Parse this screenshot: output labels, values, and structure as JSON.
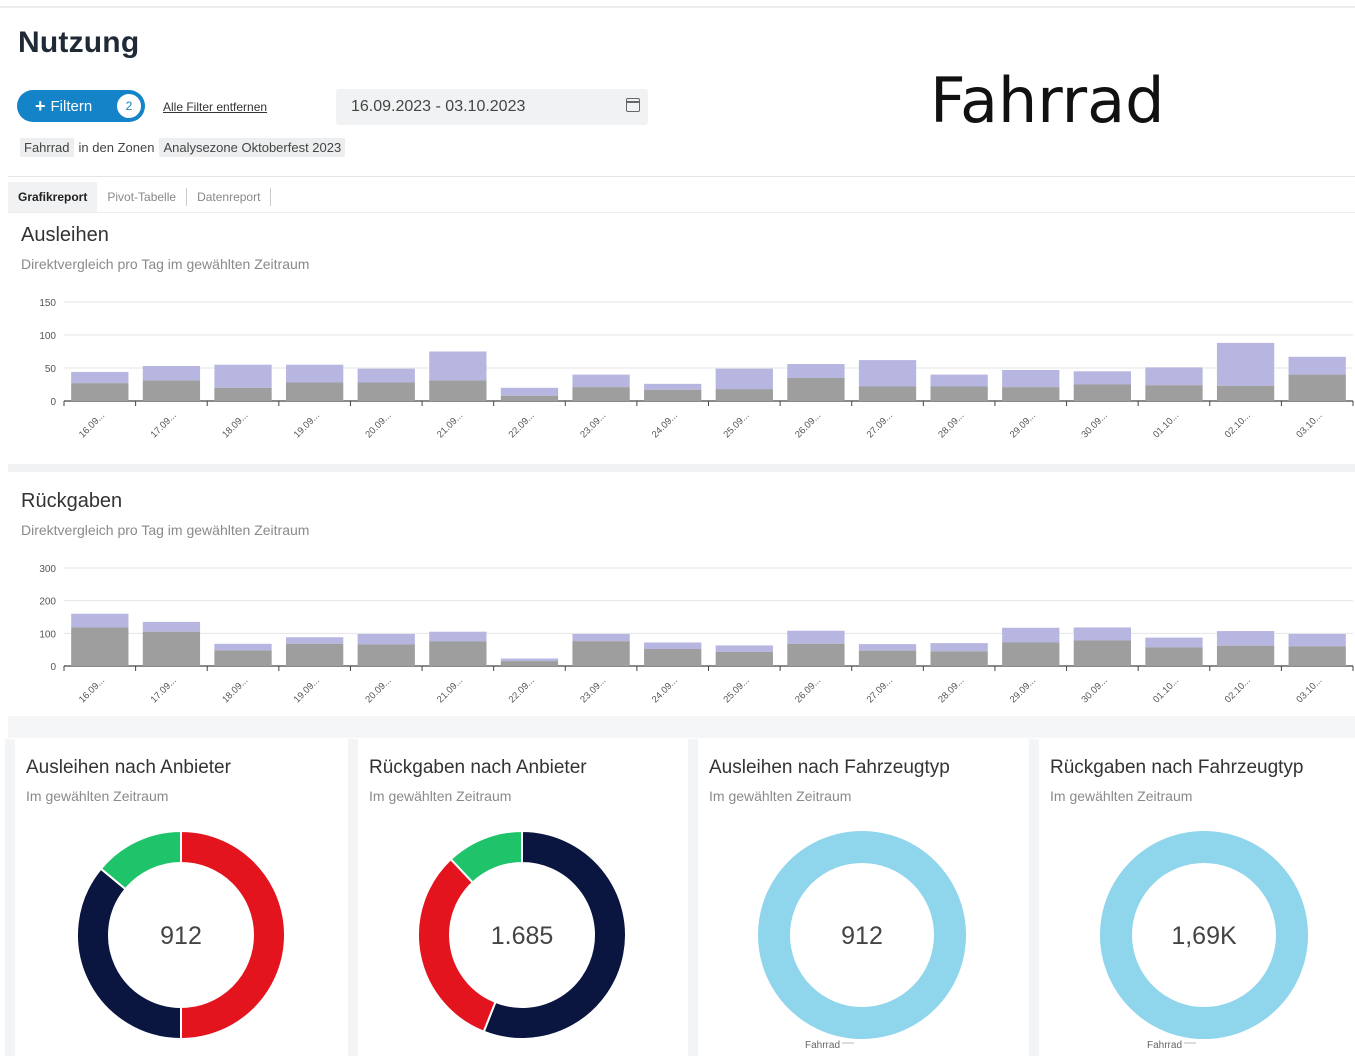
{
  "page": {
    "title": "Nutzung",
    "overlay_label": "Fahrrad"
  },
  "filter": {
    "button_label": "Filtern",
    "badge_count": "2",
    "remove_all": "Alle Filter entfernen",
    "date_range": "16.09.2023 - 03.10.2023",
    "chips": [
      "Fahrrad",
      "in den Zonen",
      "Analysezone Oktoberfest 2023"
    ]
  },
  "tabs": [
    {
      "label": "Grafikreport",
      "active": true
    },
    {
      "label": "Pivot-Tabelle",
      "active": false
    },
    {
      "label": "Datenreport",
      "active": false
    }
  ],
  "colors": {
    "accent": "#1583c7",
    "bar_bottom": "#9e9e9e",
    "bar_top": "#b6b6e0",
    "red": "#e3141e",
    "navy": "#0a1640",
    "green": "#1fc46a",
    "lightblue": "#8fd5ec"
  },
  "rentals": {
    "title": "Ausleihen",
    "subtitle": "Direktvergleich pro Tag im gewählten Zeitraum"
  },
  "returns": {
    "title": "Rückgaben",
    "subtitle": "Direktvergleich pro Tag im gewählten Zeitraum"
  },
  "cards": [
    {
      "title": "Ausleihen nach Anbieter",
      "subtitle": "Im gewählten Zeitraum",
      "center": "912",
      "footer": ""
    },
    {
      "title": "Rückgaben nach Anbieter",
      "subtitle": "Im gewählten Zeitraum",
      "center": "1.685",
      "footer": ""
    },
    {
      "title": "Ausleihen nach Fahrzeugtyp",
      "subtitle": "Im gewählten Zeitraum",
      "center": "912",
      "footer": "Fahrrad"
    },
    {
      "title": "Rückgaben nach Fahrzeugtyp",
      "subtitle": "Im gewählten Zeitraum",
      "center": "1,69K",
      "footer": "Fahrrad"
    }
  ],
  "chart_data": [
    {
      "type": "bar",
      "stacked": true,
      "categories": [
        "16.09.",
        "17.09.",
        "18.09.",
        "19.09.",
        "20.09.",
        "21.09.",
        "22.09.",
        "23.09.",
        "24.09.",
        "25.09.",
        "26.09.",
        "27.09.",
        "28.09.",
        "29.09.",
        "30.09.",
        "01.10.",
        "02.10.",
        "03.10."
      ],
      "series": [
        {
          "values": [
            27,
            31,
            20,
            28,
            28,
            31,
            8,
            21,
            17,
            18,
            35,
            22,
            22,
            21,
            25,
            24,
            23,
            40
          ]
        },
        {
          "values": [
            17,
            22,
            35,
            27,
            21,
            44,
            12,
            19,
            9,
            31,
            21,
            40,
            18,
            26,
            20,
            27,
            65,
            27
          ]
        }
      ],
      "ylim": [
        0,
        150
      ],
      "yticks": [
        0,
        50,
        100,
        150
      ],
      "grid": true
    },
    {
      "type": "bar",
      "stacked": true,
      "categories": [
        "16.09.",
        "17.09.",
        "18.09.",
        "19.09.",
        "20.09.",
        "21.09.",
        "22.09.",
        "23.09.",
        "24.09.",
        "25.09.",
        "26.09.",
        "27.09.",
        "28.09.",
        "29.09.",
        "30.09.",
        "01.10.",
        "02.10.",
        "03.10."
      ],
      "series": [
        {
          "values": [
            118,
            105,
            48,
            68,
            66,
            75,
            15,
            76,
            52,
            43,
            68,
            47,
            45,
            72,
            78,
            57,
            62,
            60
          ]
        },
        {
          "values": [
            42,
            30,
            20,
            20,
            32,
            30,
            8,
            22,
            20,
            20,
            40,
            20,
            25,
            45,
            40,
            30,
            45,
            38
          ]
        }
      ],
      "ylim": [
        0,
        300
      ],
      "yticks": [
        0,
        100,
        200,
        300
      ],
      "grid": true
    },
    {
      "type": "pie",
      "donut": true,
      "center_label": "912",
      "slices": [
        {
          "value": 50,
          "color": "#e3141e"
        },
        {
          "value": 36,
          "color": "#0a1640"
        },
        {
          "value": 14,
          "color": "#1fc46a"
        }
      ]
    },
    {
      "type": "pie",
      "donut": true,
      "center_label": "1.685",
      "slices": [
        {
          "value": 56,
          "color": "#0a1640"
        },
        {
          "value": 32,
          "color": "#e3141e"
        },
        {
          "value": 12,
          "color": "#1fc46a"
        }
      ]
    },
    {
      "type": "pie",
      "donut": true,
      "center_label": "912",
      "slices": [
        {
          "name": "Fahrrad",
          "value": 100,
          "color": "#8fd5ec"
        }
      ]
    },
    {
      "type": "pie",
      "donut": true,
      "center_label": "1,69K",
      "slices": [
        {
          "name": "Fahrrad",
          "value": 100,
          "color": "#8fd5ec"
        }
      ]
    }
  ]
}
